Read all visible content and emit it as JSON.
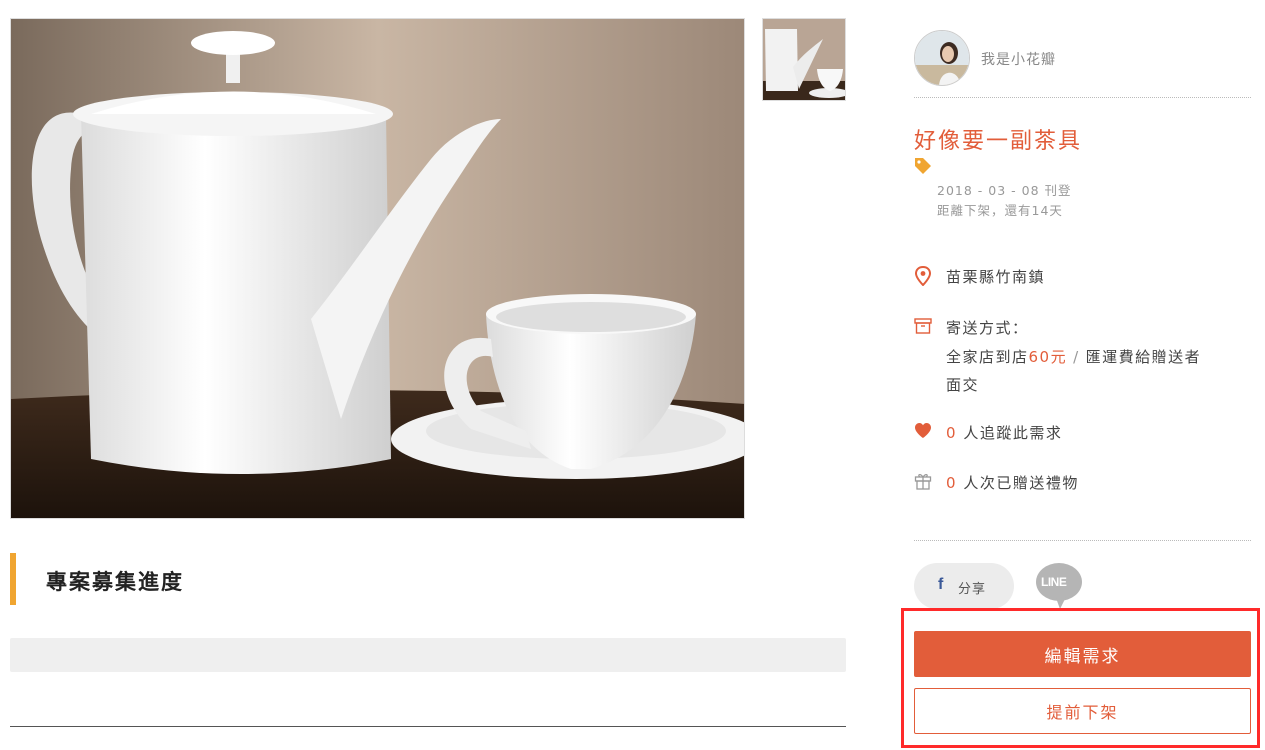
{
  "product": {
    "main_image_icon": "teapot-and-cup-photo",
    "thumbnail_icon": "teapot-and-cup-thumbnail"
  },
  "progress": {
    "heading": "專案募集進度",
    "fill_percent": 0
  },
  "poster": {
    "name": "我是小花瓣",
    "avatar_icon": "user-avatar"
  },
  "item": {
    "title": "好像要一副茶具",
    "tag_icon": "price-tag-icon",
    "posted_date": "2018 - 03 - 08 刊登",
    "remaining": "距離下架，還有14天"
  },
  "info": {
    "location_icon": "map-pin-icon",
    "location": "苗栗縣竹南鎮",
    "shipping_icon": "box-icon",
    "shipping_label": "寄送方式：",
    "shipping_option_1_prefix": "全家店到店",
    "shipping_option_1_price": "60元",
    "shipping_separator": "/",
    "shipping_option_1_suffix": "匯運費給贈送者",
    "shipping_option_2": "面交",
    "followers_icon": "heart-icon",
    "followers_count": "0",
    "followers_text": "人追蹤此需求",
    "gifts_icon": "gift-icon",
    "gifts_count": "0",
    "gifts_text": "人次已贈送禮物"
  },
  "share": {
    "facebook_letter": "f",
    "facebook_label": "分享",
    "line_label": "LINE"
  },
  "actions": {
    "edit_label": "編輯需求",
    "takedown_label": "提前下架"
  },
  "colors": {
    "accent": "#e25d3a",
    "heading_bar": "#f0a531",
    "highlight_frame": "#ff2a2a",
    "facebook": "#3b5998"
  }
}
